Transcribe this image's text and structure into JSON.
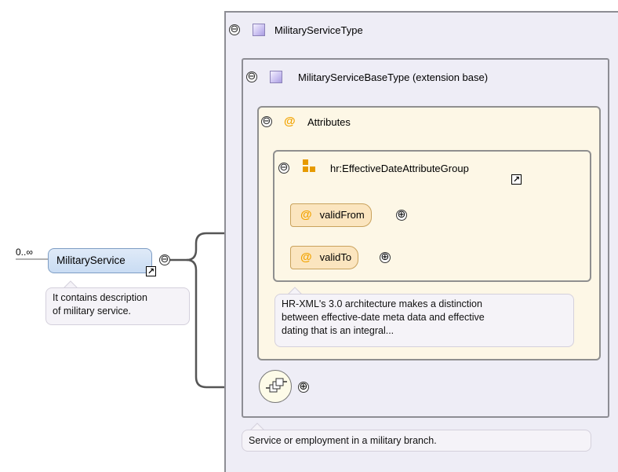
{
  "element": {
    "cardinality": "0..∞",
    "name": "MilitaryService",
    "annotation": [
      "It contains description",
      "of military service."
    ]
  },
  "type": {
    "name": "MilitaryServiceType",
    "annotation": "Service or employment in a military branch."
  },
  "base": {
    "name": "MilitaryServiceBaseType (extension base)"
  },
  "attributes": {
    "label": "Attributes",
    "group": {
      "name": "hr:EffectiveDateAttributeGroup",
      "items": [
        "validFrom",
        "validTo"
      ],
      "annotation": [
        "HR-XML's 3.0 architecture makes a distinction",
        "between effective-date meta data and effective",
        "dating that is an integral..."
      ]
    }
  },
  "symbols": {
    "collapse": "⊖",
    "expand": "⊕",
    "attribute": "@",
    "link": "↗"
  },
  "colors": {
    "type_bg": "#eeedf6",
    "attribute_bg": "#fdf7e6",
    "attribute_pill": "#fbe5bf",
    "attribute_marker": "#f2a300",
    "element_pill": "#c9dcf3"
  }
}
